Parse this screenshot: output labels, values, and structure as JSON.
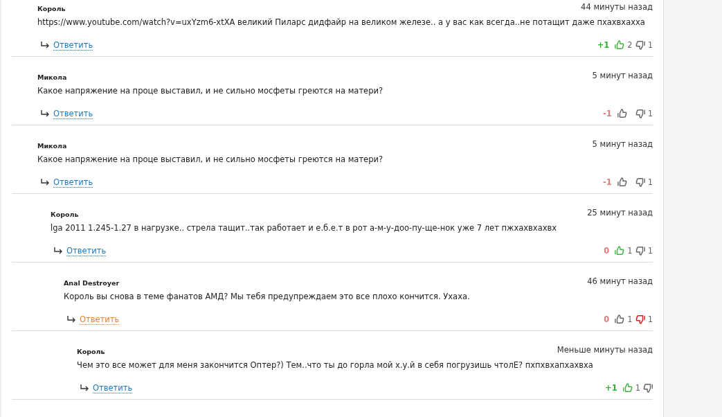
{
  "comments": [
    {
      "author": "Король",
      "time": "44 минуты назад",
      "text": "https://www.youtube.com/watch?v=uxYzm6-xtXA великий Пиларс дидфайр на великом железе.. а у вас как всегда..не потащит даже пхахвхахха",
      "reply": "Ответить",
      "reply_hovered": false,
      "rating": "+1",
      "color": "#2fae2f",
      "liked": true,
      "likes": "2",
      "disliked": false,
      "dislikes": "1"
    },
    {
      "author": "Микола",
      "time": "5 минут назад",
      "text": "Какое напряжение на проце выставил, и не сильно мосфеты греются на матери?",
      "reply": "Ответить",
      "reply_hovered": false,
      "rating": "-1",
      "color": "#ea7a7a",
      "liked": false,
      "disliked": false,
      "dislikes": "1"
    },
    {
      "author": "Микола",
      "time": "5 минут назад",
      "text": "Какое напряжение на проце выставил, и не сильно мосфеты греются на матери?",
      "reply": "Ответить",
      "reply_hovered": false,
      "rating": "-1",
      "color": "#ea7a7a",
      "liked": false,
      "disliked": false,
      "dislikes": "1",
      "children": [
        {
          "author": "Король",
          "time": "25 минут назад",
          "text": "lga 2011 1.245-1.27 в нагрузке.. стрела тащит..так работает и е.б.е.т в рот а-м-у-доо-пу-ще-нок уже 7 лет пжхахвхахвх",
          "reply": "Ответить",
          "reply_hovered": false,
          "rating": "0",
          "color": "#ea7a7a",
          "liked": true,
          "likes": "1",
          "disliked": false,
          "dislikes": "1",
          "children": [
            {
              "author": "Anal Destroyer",
              "time": "46 минут назад",
              "text": "Король вы снова в теме фанатов АМД? Мы тебя предупреждаем это все плохо кончится. Ухаха.",
              "reply": "Ответить",
              "reply_hovered": true,
              "rating": "0",
              "color": "#ea7a7a",
              "liked": false,
              "likes": "1",
              "disliked": true,
              "dislikes": "1",
              "children": [
                {
                  "author": "Король",
                  "time": "Меньше минуты назад",
                  "text": "Чем это все может для меня закончится Оптер?) Тем..что ты до горла мой х.у.й в себя погрузишь чтолЕ? пхпхвхапхахвха",
                  "reply": "Ответить",
                  "reply_hovered": false,
                  "rating": "+1",
                  "color": "#2fae2f",
                  "liked": true,
                  "likes": "1",
                  "disliked": false
                }
              ]
            }
          ]
        }
      ]
    }
  ]
}
